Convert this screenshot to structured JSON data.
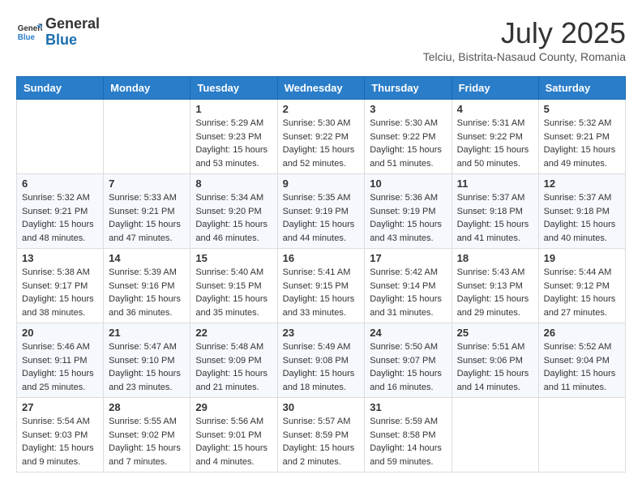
{
  "header": {
    "logo_line1": "General",
    "logo_line2": "Blue",
    "month": "July 2025",
    "location": "Telciu, Bistrita-Nasaud County, Romania"
  },
  "weekdays": [
    "Sunday",
    "Monday",
    "Tuesday",
    "Wednesday",
    "Thursday",
    "Friday",
    "Saturday"
  ],
  "weeks": [
    [
      {
        "day": "",
        "sunrise": "",
        "sunset": "",
        "daylight": ""
      },
      {
        "day": "",
        "sunrise": "",
        "sunset": "",
        "daylight": ""
      },
      {
        "day": "1",
        "sunrise": "Sunrise: 5:29 AM",
        "sunset": "Sunset: 9:23 PM",
        "daylight": "Daylight: 15 hours and 53 minutes."
      },
      {
        "day": "2",
        "sunrise": "Sunrise: 5:30 AM",
        "sunset": "Sunset: 9:22 PM",
        "daylight": "Daylight: 15 hours and 52 minutes."
      },
      {
        "day": "3",
        "sunrise": "Sunrise: 5:30 AM",
        "sunset": "Sunset: 9:22 PM",
        "daylight": "Daylight: 15 hours and 51 minutes."
      },
      {
        "day": "4",
        "sunrise": "Sunrise: 5:31 AM",
        "sunset": "Sunset: 9:22 PM",
        "daylight": "Daylight: 15 hours and 50 minutes."
      },
      {
        "day": "5",
        "sunrise": "Sunrise: 5:32 AM",
        "sunset": "Sunset: 9:21 PM",
        "daylight": "Daylight: 15 hours and 49 minutes."
      }
    ],
    [
      {
        "day": "6",
        "sunrise": "Sunrise: 5:32 AM",
        "sunset": "Sunset: 9:21 PM",
        "daylight": "Daylight: 15 hours and 48 minutes."
      },
      {
        "day": "7",
        "sunrise": "Sunrise: 5:33 AM",
        "sunset": "Sunset: 9:21 PM",
        "daylight": "Daylight: 15 hours and 47 minutes."
      },
      {
        "day": "8",
        "sunrise": "Sunrise: 5:34 AM",
        "sunset": "Sunset: 9:20 PM",
        "daylight": "Daylight: 15 hours and 46 minutes."
      },
      {
        "day": "9",
        "sunrise": "Sunrise: 5:35 AM",
        "sunset": "Sunset: 9:19 PM",
        "daylight": "Daylight: 15 hours and 44 minutes."
      },
      {
        "day": "10",
        "sunrise": "Sunrise: 5:36 AM",
        "sunset": "Sunset: 9:19 PM",
        "daylight": "Daylight: 15 hours and 43 minutes."
      },
      {
        "day": "11",
        "sunrise": "Sunrise: 5:37 AM",
        "sunset": "Sunset: 9:18 PM",
        "daylight": "Daylight: 15 hours and 41 minutes."
      },
      {
        "day": "12",
        "sunrise": "Sunrise: 5:37 AM",
        "sunset": "Sunset: 9:18 PM",
        "daylight": "Daylight: 15 hours and 40 minutes."
      }
    ],
    [
      {
        "day": "13",
        "sunrise": "Sunrise: 5:38 AM",
        "sunset": "Sunset: 9:17 PM",
        "daylight": "Daylight: 15 hours and 38 minutes."
      },
      {
        "day": "14",
        "sunrise": "Sunrise: 5:39 AM",
        "sunset": "Sunset: 9:16 PM",
        "daylight": "Daylight: 15 hours and 36 minutes."
      },
      {
        "day": "15",
        "sunrise": "Sunrise: 5:40 AM",
        "sunset": "Sunset: 9:15 PM",
        "daylight": "Daylight: 15 hours and 35 minutes."
      },
      {
        "day": "16",
        "sunrise": "Sunrise: 5:41 AM",
        "sunset": "Sunset: 9:15 PM",
        "daylight": "Daylight: 15 hours and 33 minutes."
      },
      {
        "day": "17",
        "sunrise": "Sunrise: 5:42 AM",
        "sunset": "Sunset: 9:14 PM",
        "daylight": "Daylight: 15 hours and 31 minutes."
      },
      {
        "day": "18",
        "sunrise": "Sunrise: 5:43 AM",
        "sunset": "Sunset: 9:13 PM",
        "daylight": "Daylight: 15 hours and 29 minutes."
      },
      {
        "day": "19",
        "sunrise": "Sunrise: 5:44 AM",
        "sunset": "Sunset: 9:12 PM",
        "daylight": "Daylight: 15 hours and 27 minutes."
      }
    ],
    [
      {
        "day": "20",
        "sunrise": "Sunrise: 5:46 AM",
        "sunset": "Sunset: 9:11 PM",
        "daylight": "Daylight: 15 hours and 25 minutes."
      },
      {
        "day": "21",
        "sunrise": "Sunrise: 5:47 AM",
        "sunset": "Sunset: 9:10 PM",
        "daylight": "Daylight: 15 hours and 23 minutes."
      },
      {
        "day": "22",
        "sunrise": "Sunrise: 5:48 AM",
        "sunset": "Sunset: 9:09 PM",
        "daylight": "Daylight: 15 hours and 21 minutes."
      },
      {
        "day": "23",
        "sunrise": "Sunrise: 5:49 AM",
        "sunset": "Sunset: 9:08 PM",
        "daylight": "Daylight: 15 hours and 18 minutes."
      },
      {
        "day": "24",
        "sunrise": "Sunrise: 5:50 AM",
        "sunset": "Sunset: 9:07 PM",
        "daylight": "Daylight: 15 hours and 16 minutes."
      },
      {
        "day": "25",
        "sunrise": "Sunrise: 5:51 AM",
        "sunset": "Sunset: 9:06 PM",
        "daylight": "Daylight: 15 hours and 14 minutes."
      },
      {
        "day": "26",
        "sunrise": "Sunrise: 5:52 AM",
        "sunset": "Sunset: 9:04 PM",
        "daylight": "Daylight: 15 hours and 11 minutes."
      }
    ],
    [
      {
        "day": "27",
        "sunrise": "Sunrise: 5:54 AM",
        "sunset": "Sunset: 9:03 PM",
        "daylight": "Daylight: 15 hours and 9 minutes."
      },
      {
        "day": "28",
        "sunrise": "Sunrise: 5:55 AM",
        "sunset": "Sunset: 9:02 PM",
        "daylight": "Daylight: 15 hours and 7 minutes."
      },
      {
        "day": "29",
        "sunrise": "Sunrise: 5:56 AM",
        "sunset": "Sunset: 9:01 PM",
        "daylight": "Daylight: 15 hours and 4 minutes."
      },
      {
        "day": "30",
        "sunrise": "Sunrise: 5:57 AM",
        "sunset": "Sunset: 8:59 PM",
        "daylight": "Daylight: 15 hours and 2 minutes."
      },
      {
        "day": "31",
        "sunrise": "Sunrise: 5:59 AM",
        "sunset": "Sunset: 8:58 PM",
        "daylight": "Daylight: 14 hours and 59 minutes."
      },
      {
        "day": "",
        "sunrise": "",
        "sunset": "",
        "daylight": ""
      },
      {
        "day": "",
        "sunrise": "",
        "sunset": "",
        "daylight": ""
      }
    ]
  ]
}
